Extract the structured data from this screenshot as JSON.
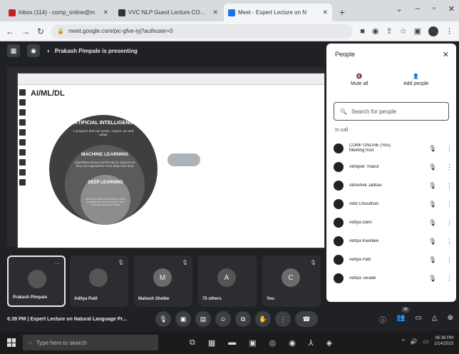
{
  "browser": {
    "tabs": [
      {
        "title": "Inbox (114) - comp_online@m",
        "fav_color": "#c5221f"
      },
      {
        "title": "VVC NLP Guest Lecture COMP / L",
        "fav_color": "#333333"
      },
      {
        "title": "Meet - Expert Lecture on N",
        "fav_color": "#1a73e8"
      }
    ],
    "new_tab": "+",
    "close_glyph": "✕",
    "url": "meet.google.com/pic-gfve-iyj?authuser=0"
  },
  "meet": {
    "presenting_text": "Prakash Pimpale is presenting",
    "slide_title": "AI/ML/DL",
    "ai_title": "ARTIFICIAL INTELLIGENCE",
    "ai_sub": "A program that can sense, reason, act and adapt",
    "ml_title": "MACHINE LEARNING",
    "ml_sub": "Algorithms whose performance improve as they are exposed to more data over time",
    "dl_title": "DEEP LEARNING",
    "dl_sub": "Subset of machine learning in which multilayered neural networks learn from vast amounts of data",
    "time": "6:39 PM",
    "meeting_name": "Expert Lecture on Natural Language Pr...",
    "participant_count": "28"
  },
  "people": {
    "title": "People",
    "mute_all": "Mute all",
    "add_people": "Add people",
    "search_placeholder": "Search for people",
    "section": "In call",
    "list": [
      {
        "name": "COMP ONLINE (You)",
        "sub": "Meeting host"
      },
      {
        "name": "Abhijeet Thakur",
        "sub": ""
      },
      {
        "name": "Abhishek Jadhav",
        "sub": ""
      },
      {
        "name": "Aditi Choudhari",
        "sub": ""
      },
      {
        "name": "Aditya Dalvi",
        "sub": ""
      },
      {
        "name": "Aditya Kavitake",
        "sub": ""
      },
      {
        "name": "Aditya Patil",
        "sub": ""
      },
      {
        "name": "Aditya Tavade",
        "sub": ""
      }
    ]
  },
  "tiles": [
    {
      "name": "Prakash Pimpale",
      "initial": ""
    },
    {
      "name": "Aditya Patil",
      "initial": ""
    },
    {
      "name": "Mahesh Shelke",
      "initial": "M"
    },
    {
      "name": "75 others",
      "initial": "A"
    },
    {
      "name": "You",
      "initial": "C"
    }
  ],
  "taskbar": {
    "search": "Type here to search",
    "time": "06:39 PM",
    "date": "1/14/2023"
  }
}
